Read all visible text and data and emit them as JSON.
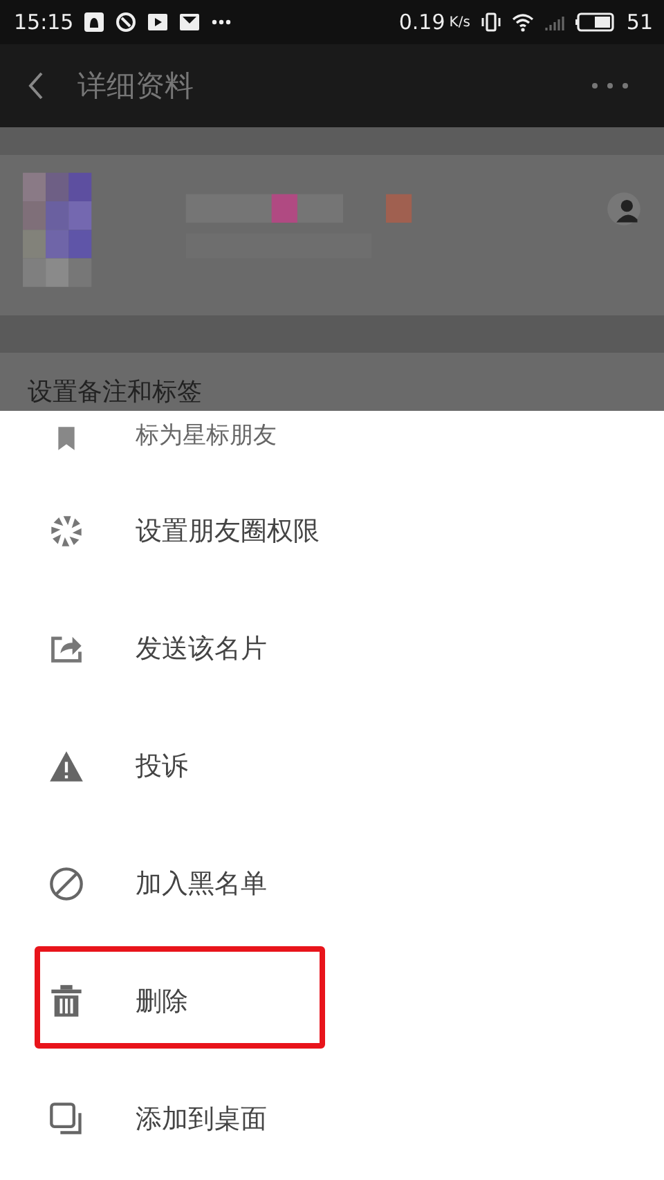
{
  "status_bar": {
    "time": "15:15",
    "speed": "0.19",
    "speed_unit": "K/s",
    "battery": "51"
  },
  "toolbar": {
    "title": "详细资料"
  },
  "section_label": "设置备注和标签",
  "menu": [
    {
      "kind": "star",
      "label": "标为星标朋友",
      "highlighted": false
    },
    {
      "kind": "aperture",
      "label": "设置朋友圈权限",
      "highlighted": false
    },
    {
      "kind": "share",
      "label": "发送该名片",
      "highlighted": false
    },
    {
      "kind": "warning",
      "label": "投诉",
      "highlighted": false
    },
    {
      "kind": "block",
      "label": "加入黑名单",
      "highlighted": false
    },
    {
      "kind": "trash",
      "label": "删除",
      "highlighted": true
    },
    {
      "kind": "desktop",
      "label": "添加到桌面",
      "highlighted": false
    }
  ]
}
